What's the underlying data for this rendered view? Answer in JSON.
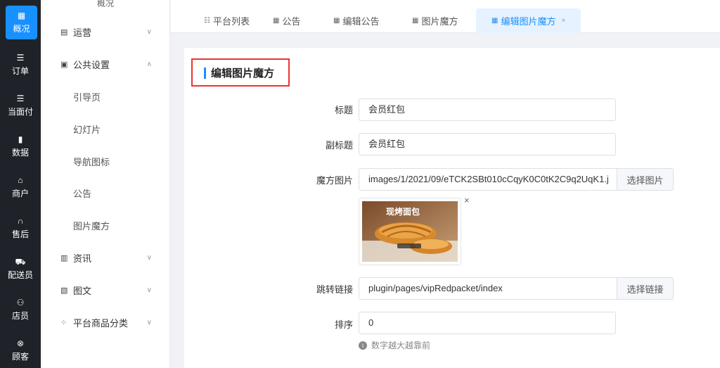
{
  "rail": {
    "items": [
      {
        "label": "概况",
        "icon": "grid-icon",
        "glyph": "▦"
      },
      {
        "label": "订单",
        "icon": "list-icon",
        "glyph": "☰"
      },
      {
        "label": "当面付",
        "icon": "list-icon",
        "glyph": "☰"
      },
      {
        "label": "数据",
        "icon": "bar-chart-icon",
        "glyph": "▮"
      },
      {
        "label": "商户",
        "icon": "store-icon",
        "glyph": "⌂"
      },
      {
        "label": "售后",
        "icon": "headset-icon",
        "glyph": "∩"
      },
      {
        "label": "配送员",
        "icon": "delivery-icon",
        "glyph": "⛟"
      },
      {
        "label": "店员",
        "icon": "users-icon",
        "glyph": "⚇"
      },
      {
        "label": "顾客",
        "icon": "customer-icon",
        "glyph": "⊗"
      }
    ]
  },
  "submenu": {
    "top_label": "概况",
    "groups": [
      {
        "label": "运营",
        "icon": "shop-icon",
        "glyph": "▤",
        "chevron": "∨"
      },
      {
        "label": "公共设置",
        "icon": "image-icon",
        "glyph": "▣",
        "chevron": "∧"
      },
      {
        "label": "资讯",
        "icon": "news-icon",
        "glyph": "▥",
        "chevron": "∨"
      },
      {
        "label": "图文",
        "icon": "picture-icon",
        "glyph": "▧",
        "chevron": "∨"
      },
      {
        "label": "平台商品分类",
        "icon": "category-icon",
        "glyph": "⁘",
        "chevron": "∨"
      }
    ],
    "children": [
      "引导页",
      "幻灯片",
      "导航图标",
      "公告",
      "图片魔方"
    ]
  },
  "tabs": [
    {
      "label": "平台列表",
      "glyph": "☷"
    },
    {
      "label": "公告",
      "glyph": "▦"
    },
    {
      "label": "编辑公告",
      "glyph": "▦"
    },
    {
      "label": "图片魔方",
      "glyph": "▦"
    },
    {
      "label": "编辑图片魔方",
      "glyph": "▦",
      "close": "×"
    }
  ],
  "form": {
    "title": "编辑图片魔方",
    "title_label": "标题",
    "title_value": "会员红包",
    "subtitle_label": "副标题",
    "subtitle_value": "会员红包",
    "image_label": "魔方图片",
    "image_value": "images/1/2021/09/eTCK2SBt010cCqyK0C0tK2C9q2UqK1.j",
    "image_button": "选择图片",
    "thumb_caption": "现烤面包",
    "thumb_close": "×",
    "link_label": "跳转链接",
    "link_value": "plugin/pages/vipRedpacket/index",
    "link_button": "选择链接",
    "sort_label": "排序",
    "sort_value": "0",
    "sort_hint": "数字越大越靠前"
  },
  "colors": {
    "accent": "#1890ff",
    "rail_bg": "#1f2329",
    "highlight_border": "#e33333"
  }
}
